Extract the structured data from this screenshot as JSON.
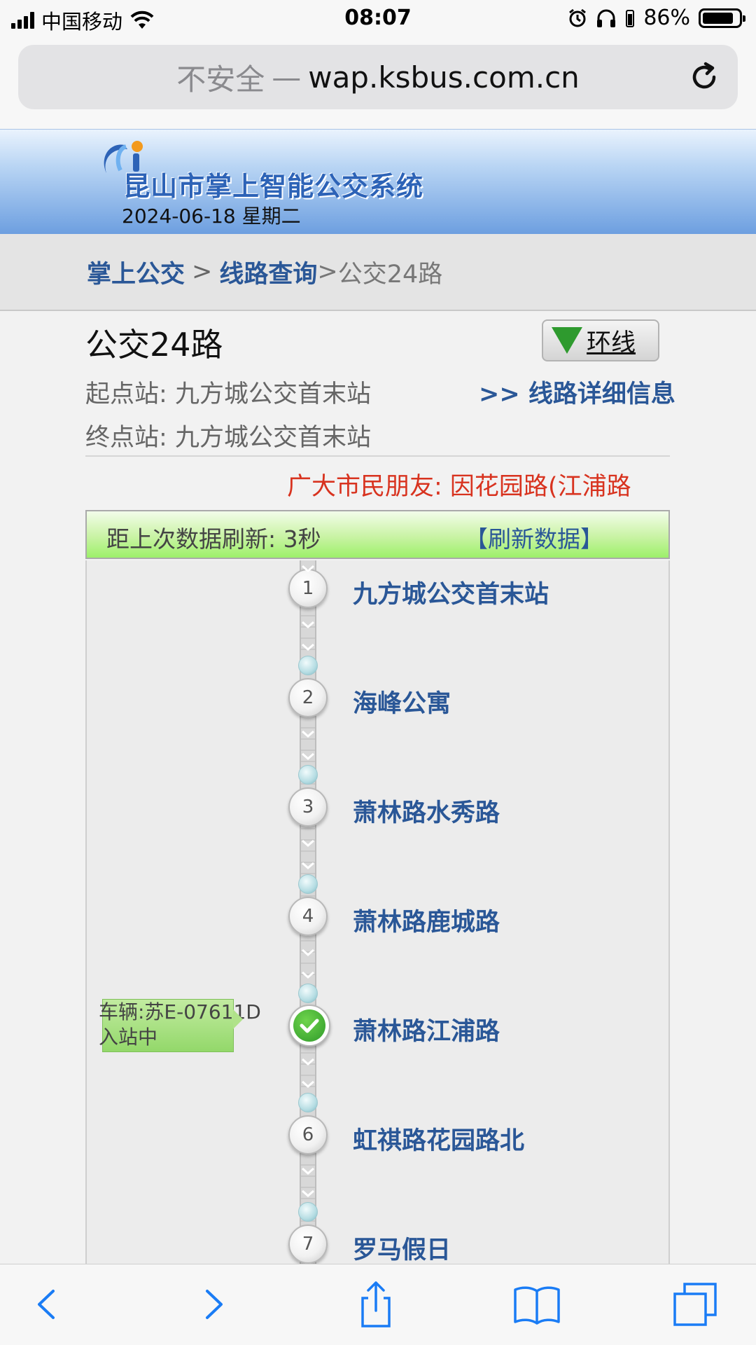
{
  "status_bar": {
    "carrier": "中国移动",
    "time": "08:07",
    "battery": "86%",
    "battery_level": 0.86
  },
  "browser": {
    "insecure_label": "不安全",
    "separator": "—",
    "host": "wap.ksbus.com.cn",
    "reload_icon": "reload-icon"
  },
  "header": {
    "site_title": "昆山市掌上智能公交系统",
    "date": "2024-06-18 星期二"
  },
  "breadcrumb": {
    "home": "掌上公交",
    "sep1": ">",
    "route_query": "线路查询",
    "sep2": ">",
    "current": "公交24路"
  },
  "route": {
    "title": "公交24路",
    "direction_label": "环线",
    "start_label": "起点站:",
    "start_value": "九方城公交首末站",
    "end_label": "终点站:",
    "end_value": "九方城公交首末站",
    "detail_link": ">> 线路详细信息",
    "notice": "广大市民朋友: 因花园路(江浦路"
  },
  "refresh": {
    "label": "距上次数据刷新: 3秒",
    "button": "【刷新数据】"
  },
  "stops": [
    {
      "num": "1",
      "name": "九方城公交首末站"
    },
    {
      "num": "2",
      "name": "海峰公寓"
    },
    {
      "num": "3",
      "name": "萧林路水秀路"
    },
    {
      "num": "4",
      "name": "萧林路鹿城路"
    },
    {
      "num": "",
      "name": "萧林路江浦路",
      "current": true
    },
    {
      "num": "6",
      "name": "虹祺路花园路北"
    },
    {
      "num": "7",
      "name": "罗马假日"
    }
  ],
  "bus": {
    "plate": "车辆:苏E-07611D",
    "status": "入站中"
  },
  "colors": {
    "link_blue": "#2a5797",
    "notice_red": "#d8331f",
    "header_blue": "#6d9fe0",
    "refresh_green": "#9df06a"
  }
}
